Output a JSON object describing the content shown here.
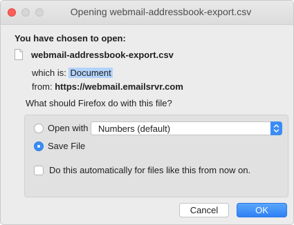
{
  "window": {
    "title": "Opening webmail-addressbook-export.csv"
  },
  "dialog": {
    "heading": "You have chosen to open:",
    "file_name": "webmail-addressbook-export.csv",
    "type_label": "which is: ",
    "type_value": "Document",
    "from_label": "from: ",
    "from_value": "https://webmail.emailsrvr.com",
    "question": "What should Firefox do with this file?"
  },
  "options": {
    "open_with_label": "Open with",
    "open_with_selected": "Numbers (default)",
    "open_with_checked": false,
    "save_file_label": "Save File",
    "save_file_checked": true,
    "auto_label": "Do this automatically for files like this from now on.",
    "auto_checked": false
  },
  "buttons": {
    "cancel_label": "Cancel",
    "ok_label": "OK"
  },
  "colors": {
    "accent": "#3a8cf5",
    "close_button": "#fc5f57",
    "selection_highlight": "#b3d3fb"
  },
  "icons": {
    "file": "document-file-icon",
    "stepper": "chevron-up-down-icon"
  }
}
